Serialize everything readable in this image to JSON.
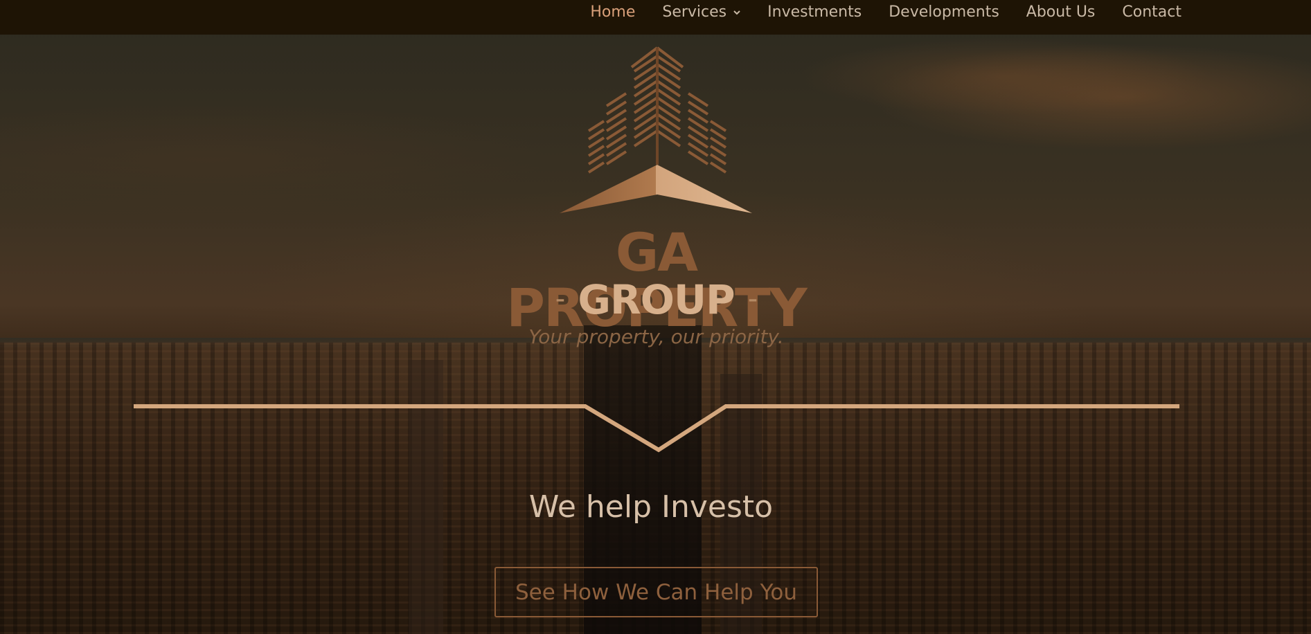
{
  "nav": {
    "items": [
      {
        "label": "Home",
        "active": true
      },
      {
        "label": "Services",
        "has_dropdown": true
      },
      {
        "label": "Investments"
      },
      {
        "label": "Developments"
      },
      {
        "label": "About Us"
      },
      {
        "label": "Contact"
      }
    ]
  },
  "hero": {
    "brand_line1": "GA PROPERTY",
    "brand_line2": "GROUP",
    "brand_dash": "-",
    "tagline": "Your property, our priority.",
    "headline": "We help Investo",
    "cta_label": "See How We Can Help You"
  },
  "colors": {
    "nav_bg": "#1e1405",
    "nav_text": "#c9b9a6",
    "nav_active": "#d9a07a",
    "brand_dark": "#8a5a36",
    "brand_light": "#d7b08c",
    "divider": "#d4a77e"
  },
  "icons": {
    "dropdown": "chevron-down-icon",
    "logo": "building-logo-icon"
  }
}
